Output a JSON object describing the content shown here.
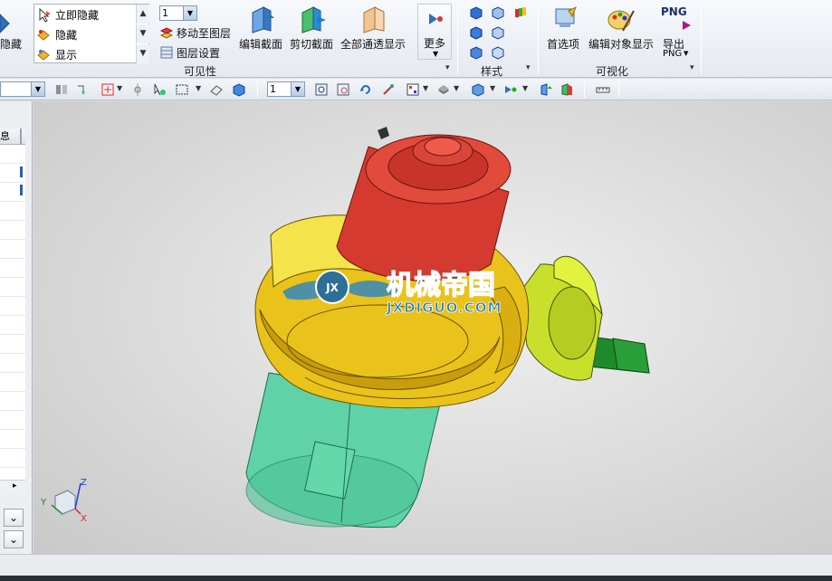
{
  "ribbon": {
    "hide_label": "隐藏",
    "visibility_items": [
      "立即隐藏",
      "隐藏",
      "显示"
    ],
    "layer_combo_value": "1",
    "move_to_layer": "移动至图层",
    "layer_settings": "图层设置",
    "edit_section": "编辑截面",
    "clip_section": "剪切截面",
    "show_all_through": "全部通透显示",
    "more": "更多",
    "group_visibility": "可见性",
    "group_style": "样式",
    "preferences": "首选项",
    "edit_object_display": "编辑对象显示",
    "png_badge": "PNG",
    "export": "导出",
    "export_sub": "PNG",
    "group_visualization": "可视化"
  },
  "toolbar": {
    "layer_combo_value": "1"
  },
  "nav": {
    "header": "息"
  },
  "viewport": {
    "triad": {
      "x": "X",
      "y": "Y",
      "z": "Z"
    },
    "watermark_cn": "机械帝国",
    "watermark_en": "JXDIGUO.COM"
  },
  "colors": {
    "red_part": "#d43a2f",
    "yellow_part": "#e9c21b",
    "green_part": "#5fd3a7",
    "lime_part": "#c8e02c",
    "dark_green": "#1f8a2c",
    "ribbon_bg": "#e8edf3"
  },
  "icons": [
    "cursor-hide-icon",
    "hide-icon",
    "show-icon",
    "move-layer-icon",
    "layer-settings-icon",
    "edit-section-icon",
    "clip-section-icon",
    "show-through-icon",
    "more-icon",
    "preferences-icon",
    "edit-display-icon",
    "export-png-icon"
  ]
}
